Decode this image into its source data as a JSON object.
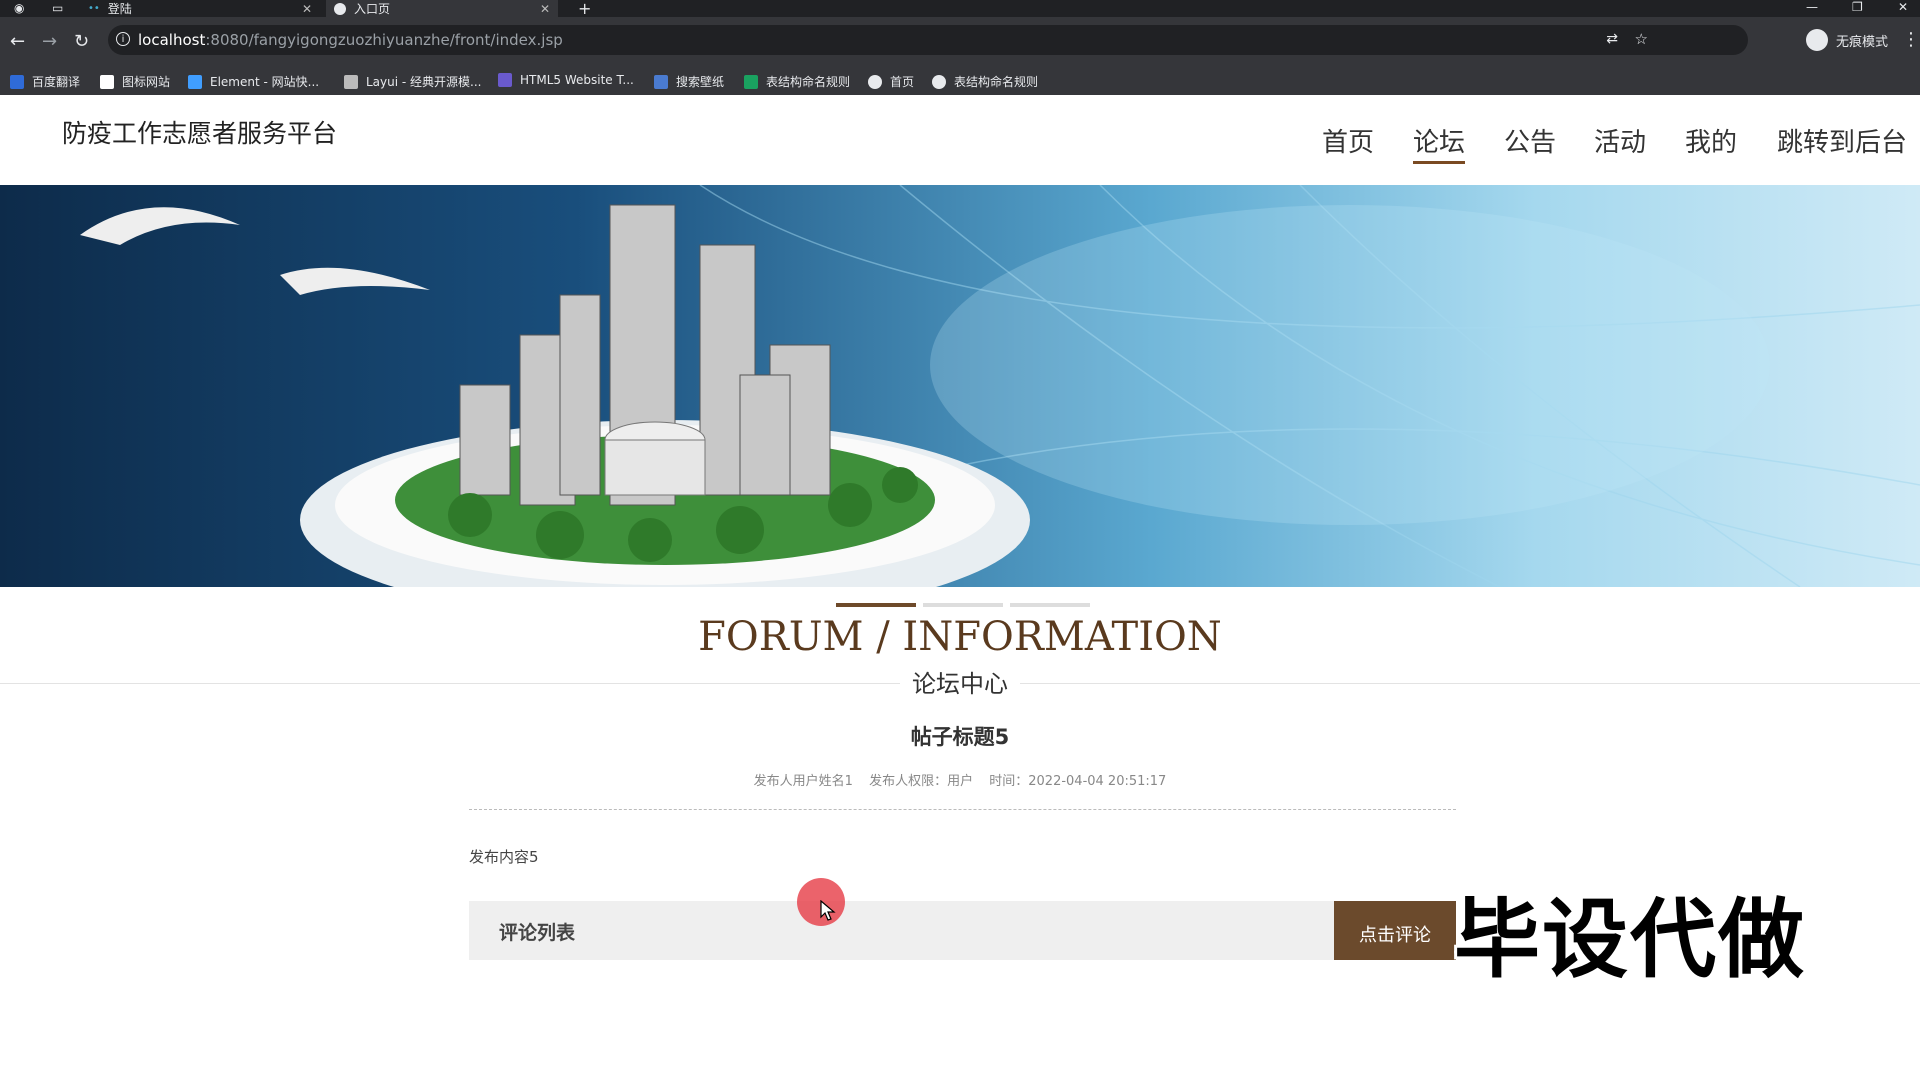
{
  "browser": {
    "tabs": [
      {
        "label": "登陆",
        "active": false
      },
      {
        "label": "入口页",
        "active": true
      }
    ],
    "url_host": "localhost",
    "url_path": ":8080/fangyigongzuozhiyuanzhe/front/index.jsp",
    "profile_label": "无痕模式",
    "bookmarks": [
      {
        "label": "百度翻译",
        "color": "#2f6bd8"
      },
      {
        "label": "图标网站",
        "color": "#ffffff"
      },
      {
        "label": "Element - 网站快...",
        "color": "#409eff"
      },
      {
        "label": "Layui - 经典开源模...",
        "color": "#bbbbbb"
      },
      {
        "label": "HTML5 Website T...",
        "color": "#6a5acd"
      },
      {
        "label": "搜索壁纸",
        "color": "#4a7bd0"
      },
      {
        "label": "表结构命名规则",
        "color": "#1aa260"
      },
      {
        "label": "首页",
        "color": "#e8eaed"
      },
      {
        "label": "表结构命名规则",
        "color": "#e8eaed"
      }
    ]
  },
  "site": {
    "title": "防疫工作志愿者服务平台",
    "nav": [
      {
        "label": "首页",
        "active": false
      },
      {
        "label": "论坛",
        "active": true
      },
      {
        "label": "公告",
        "active": false
      },
      {
        "label": "活动",
        "active": false
      },
      {
        "label": "我的",
        "active": false
      },
      {
        "label": "跳转到后台",
        "active": false
      }
    ],
    "accent_color": "#6b4a2c"
  },
  "section": {
    "title": "FORUM / INFORMATION",
    "subtitle": "论坛中心"
  },
  "post": {
    "title": "帖子标题5",
    "author": "发布人用户姓名1",
    "role": "发布人权限：用户",
    "time": "时间：2022-04-04 20:51:17",
    "content": "发布内容5"
  },
  "comments": {
    "header": "评论列表",
    "button_label": "点击评论"
  },
  "carousel": {
    "active_index": 0,
    "count": 3
  },
  "watermark": "毕设代做"
}
